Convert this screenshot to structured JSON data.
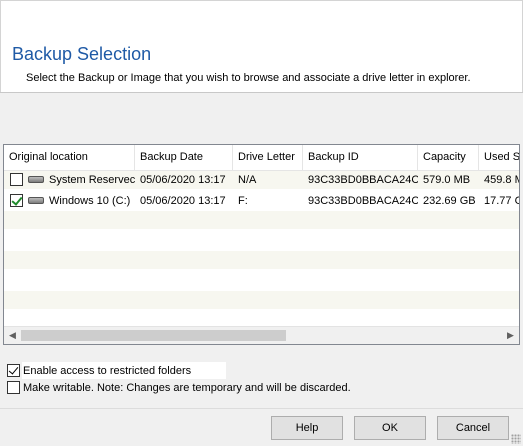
{
  "header": {
    "title": "Backup Selection",
    "subtitle": "Select the Backup or Image that you wish to browse and associate a drive letter in explorer."
  },
  "grid": {
    "columns": [
      "Original location",
      "Backup Date",
      "Drive Letter",
      "Backup ID",
      "Capacity",
      "Used S"
    ],
    "rows": [
      {
        "checked": false,
        "location": "System Reservec",
        "date": "05/06/2020 13:17",
        "drive": "N/A",
        "id": "93C33BD0BBACA24C",
        "capacity": "579.0 MB",
        "used": "459.8 M"
      },
      {
        "checked": true,
        "location": "Windows 10 (C:)",
        "date": "05/06/2020 13:17",
        "drive": "F:",
        "id": "93C33BD0BBACA24C",
        "capacity": "232.69 GB",
        "used": "17.77 G"
      }
    ]
  },
  "options": {
    "restricted": {
      "checked": true,
      "label": "Enable access to restricted folders"
    },
    "writable": {
      "checked": false,
      "label": "Make writable. Note: Changes are temporary and will be discarded."
    }
  },
  "buttons": {
    "help": "Help",
    "ok": "OK",
    "cancel": "Cancel"
  },
  "colors": {
    "title": "#1f5aa6",
    "check": "#1e8a2b"
  }
}
